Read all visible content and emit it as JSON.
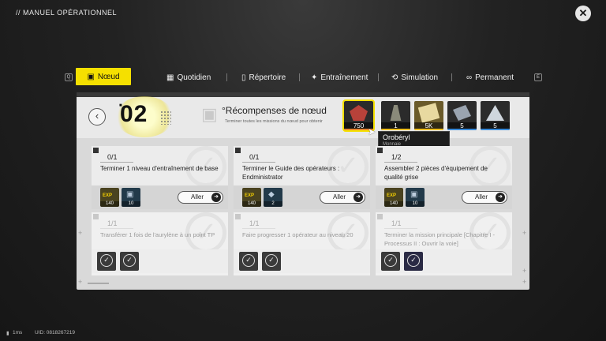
{
  "header": {
    "title": "// MANUEL OPÉRATIONNEL",
    "close_icon": "close-icon"
  },
  "tabs": {
    "left_key": "Q",
    "right_key": "E",
    "items": [
      {
        "label": "Nœud",
        "icon": "node-icon",
        "active": true
      },
      {
        "label": "Quotidien",
        "icon": "calendar-icon",
        "active": false
      },
      {
        "label": "Répertoire",
        "icon": "book-icon",
        "active": false
      },
      {
        "label": "Entraînement",
        "icon": "training-icon",
        "active": false
      },
      {
        "label": "Simulation",
        "icon": "simulation-icon",
        "active": false
      },
      {
        "label": "Permanent",
        "icon": "link-icon",
        "active": false
      }
    ]
  },
  "node": {
    "number": "02",
    "reward_title": "°Récompenses de nœud",
    "reward_sub": "Terminer toutes les missions du nœud pour obtenir",
    "rewards": [
      {
        "qty": "750",
        "icon": "oroberyl-icon",
        "rarity_color": "#e8872c",
        "bg": "#7a3030"
      },
      {
        "qty": "1",
        "icon": "tower-icon",
        "rarity_color": "#f0c020",
        "bg": "#3a3a3a"
      },
      {
        "qty": "5K",
        "icon": "tickets-icon",
        "rarity_color": "#f0c020",
        "bg": "#6a5a2a"
      },
      {
        "qty": "5",
        "icon": "material-icon",
        "rarity_color": "#3a8ad8",
        "bg": "#2e3a4a"
      },
      {
        "qty": "5",
        "icon": "prism-icon",
        "rarity_color": "#3a8ad8",
        "bg": "#2e3a4a"
      }
    ]
  },
  "tooltip": {
    "name": "Orobéryl",
    "type": "Monnaie"
  },
  "missions": [
    {
      "progress": "0/1",
      "desc": "Terminer 1 niveau d'entraînement de base",
      "locked": false,
      "rewards": [
        {
          "kind": "exp",
          "label": "EXP",
          "num": "140"
        },
        {
          "kind": "blue",
          "glyph": "▣",
          "num": "10"
        }
      ],
      "go": "Aller"
    },
    {
      "progress": "0/1",
      "desc": "Terminer le Guide des opérateurs : Endministrator",
      "locked": false,
      "rewards": [
        {
          "kind": "exp",
          "label": "EXP",
          "num": "140"
        },
        {
          "kind": "blue",
          "glyph": "◆",
          "num": "2"
        }
      ],
      "go": "Aller"
    },
    {
      "progress": "1/2",
      "desc": "Assembler 2 pièces d'équipement de qualité grise",
      "locked": false,
      "rewards": [
        {
          "kind": "exp",
          "label": "EXP",
          "num": "140"
        },
        {
          "kind": "blue",
          "glyph": "▣",
          "num": "10"
        }
      ],
      "go": "Aller"
    },
    {
      "progress": "1/1",
      "desc": "Transférer 1 fois de l'aurylène à un point TP",
      "locked": true,
      "rewards": [
        {
          "kind": "chk",
          "glyph": "✓"
        },
        {
          "kind": "chk",
          "glyph": "✓"
        }
      ]
    },
    {
      "progress": "1/1",
      "desc": "Faire progresser 1 opérateur au niveau 20",
      "locked": true,
      "rewards": [
        {
          "kind": "chk",
          "glyph": "✓"
        },
        {
          "kind": "chk",
          "glyph": "✓"
        }
      ]
    },
    {
      "progress": "1/1",
      "desc": "Terminer la mission principale [Chapitre I - Processus II : Ouvrir la voie]",
      "locked": true,
      "rewards": [
        {
          "kind": "chk",
          "glyph": "✓"
        },
        {
          "kind": "chk",
          "glyph": "✓"
        }
      ]
    }
  ],
  "status": {
    "ping": "1ms",
    "uid": "UID: 0818267219"
  }
}
